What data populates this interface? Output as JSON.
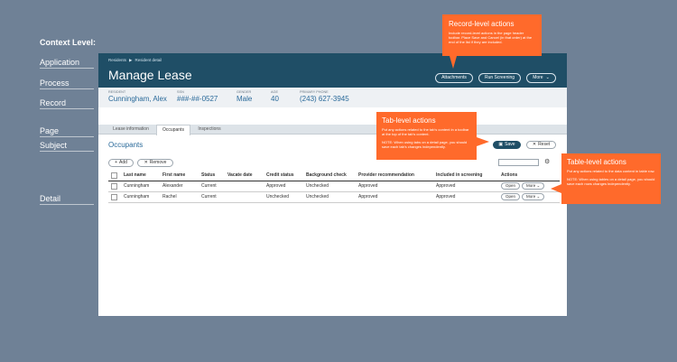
{
  "context": {
    "title": "Context Level:",
    "levels": [
      "Application",
      "Process",
      "Record",
      "Page",
      "Subject",
      "Detail"
    ]
  },
  "header": {
    "breadcrumb": [
      "Residents",
      "Resident detail"
    ],
    "breadcrumb_sep": "▶",
    "title": "Manage Lease",
    "buttons": {
      "attachments": "Attachments",
      "run_screening": "Run Screening",
      "more": "More"
    }
  },
  "summary": {
    "fields": [
      {
        "label": "RESIDENT",
        "value": "Cunningham, Alex"
      },
      {
        "label": "SSN",
        "value": "###-##-0527"
      },
      {
        "label": "GENDER",
        "value": "Male"
      },
      {
        "label": "AGE",
        "value": "40"
      },
      {
        "label": "PRIMARY PHONE",
        "value": "(243) 627-3945"
      }
    ]
  },
  "tabs": [
    "Lease information",
    "Occupants",
    "Inspections"
  ],
  "section": {
    "title": "Occupants",
    "save": "Save",
    "reset": "Reset",
    "add": "Add",
    "remove": "Remove"
  },
  "table": {
    "columns": [
      "Last name",
      "First name",
      "Status",
      "Vacate date",
      "Credit status",
      "Background check",
      "Provider recommendation",
      "Included in screening",
      "Actions"
    ],
    "rows": [
      {
        "last": "Cunningham",
        "first": "Alexander",
        "status": "Current",
        "vacate": "",
        "credit": "Approved",
        "background": "Unchecked",
        "provider": "Approved",
        "included": "Approved",
        "open": "Open",
        "more": "More"
      },
      {
        "last": "Cunningham",
        "first": "Rachel",
        "status": "Current",
        "vacate": "",
        "credit": "Unchecked",
        "background": "Unchecked",
        "provider": "Approved",
        "included": "Approved",
        "open": "Open",
        "more": "More"
      }
    ]
  },
  "callouts": {
    "record": {
      "title": "Record-level actions",
      "body": "Include record-level actions in the page header toolbar. Place Save and Cancel (in that order) at the end of the list if they are included."
    },
    "tab": {
      "title": "Tab-level actions",
      "body": "Put any actions related to the tab's content in a toolbar at the top of the tab's content.",
      "note": "NOTE: When using tabs on a detail page, you should save each tab's changes independently."
    },
    "table": {
      "title": "Table-level actions",
      "body": "Put any actions related to the data content in table row.",
      "note": "NOTE: When using tables on a detail page, you should save each rows changes independently."
    }
  },
  "colors": {
    "background": "#6f8196",
    "header": "#1f4e66",
    "callout": "#ff6a2b",
    "link": "#2a6a9a"
  }
}
